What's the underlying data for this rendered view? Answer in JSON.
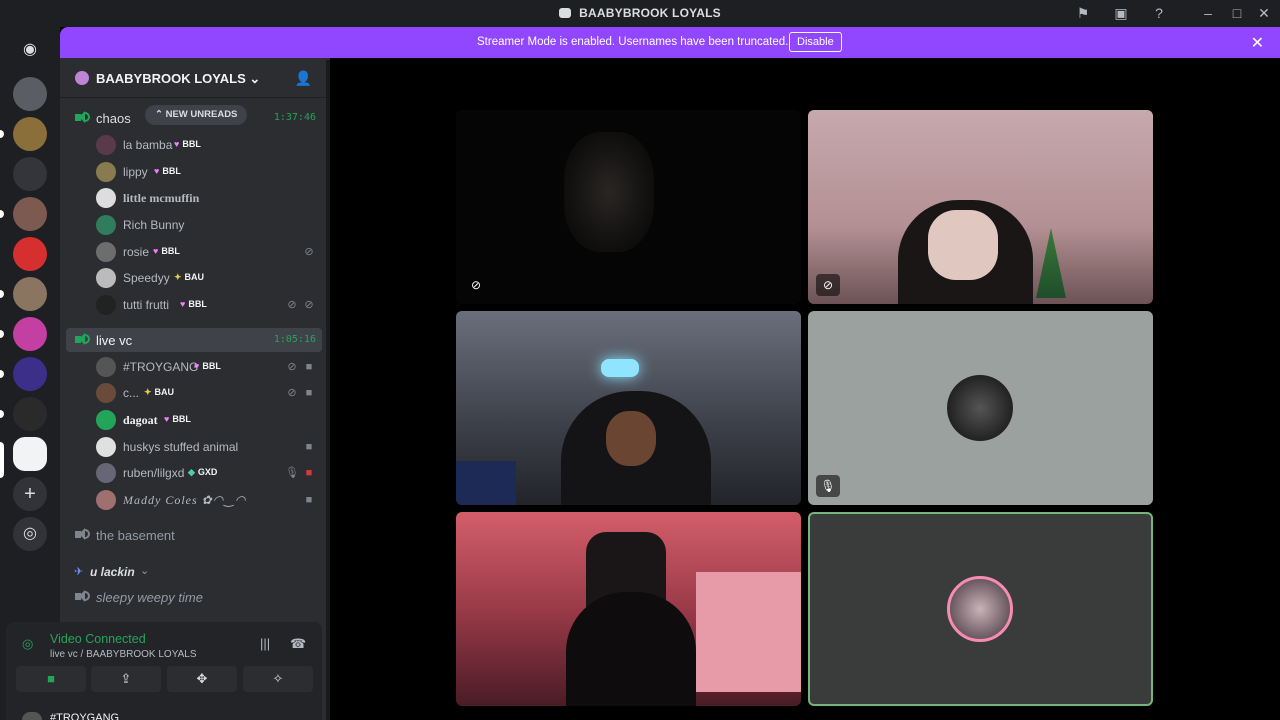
{
  "window": {
    "title": "BAABYBROOK LOYALS"
  },
  "banner": {
    "text": "Streamer Mode is enabled. Usernames have been truncated.",
    "button": "Disable"
  },
  "server": {
    "name": "BAABYBROOK LOYALS"
  },
  "unreads": "NEW UNREADS",
  "channels": {
    "chaos": {
      "name": "chaos",
      "timer": "1:37:46"
    },
    "livevc": {
      "name": "live vc",
      "timer": "1:05:16"
    },
    "basement": {
      "name": "the basement"
    },
    "sleepy": {
      "name": "sleepy weepy time"
    }
  },
  "category": "u lackin",
  "chaos_users": [
    {
      "name": "la bamba",
      "tag": "BBL"
    },
    {
      "name": "lippy",
      "tag": "BBL"
    },
    {
      "name": "little mcmuffin",
      "tag": ""
    },
    {
      "name": "Rich Bunny",
      "tag": ""
    },
    {
      "name": "rosie",
      "tag": "BBL"
    },
    {
      "name": "Speedyy",
      "tag": "BAU"
    },
    {
      "name": "tutti frutti",
      "tag": "BBL"
    }
  ],
  "live_users": [
    {
      "name": "#TROYGANG",
      "tag": "BBL"
    },
    {
      "name": "c...",
      "tag": "BAU"
    },
    {
      "name": "dagoat",
      "tag": "BBL"
    },
    {
      "name": "huskys stuffed animal",
      "tag": ""
    },
    {
      "name": "ruben/lilgxd",
      "tag": "GXD"
    },
    {
      "name": "Maddy Coles ✿◠‿◠",
      "tag": ""
    }
  ],
  "voice": {
    "status": "Video Connected",
    "location": "live vc / BAABYBROOK LOYALS",
    "next_user": "#TROYGANG"
  },
  "colors": {
    "brand": "#9147ff",
    "online": "#23a559",
    "sidebar": "#2b2d31",
    "rail": "#1e1f22"
  }
}
